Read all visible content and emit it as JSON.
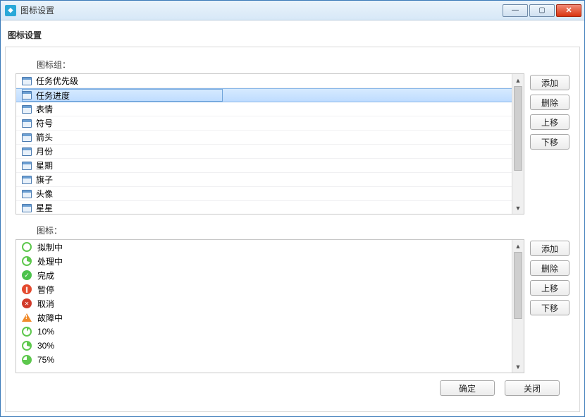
{
  "window": {
    "title": "图标设置"
  },
  "panel": {
    "header": "图标设置"
  },
  "labels": {
    "groups": "图标组：",
    "icons": "图标："
  },
  "groups": [
    {
      "label": "任务优先级"
    },
    {
      "label": "任务进度",
      "selected": true
    },
    {
      "label": "表情"
    },
    {
      "label": "符号"
    },
    {
      "label": "箭头"
    },
    {
      "label": "月份"
    },
    {
      "label": "星期"
    },
    {
      "label": "旗子"
    },
    {
      "label": "头像"
    },
    {
      "label": "星星"
    }
  ],
  "icons": [
    {
      "label": "拟制中",
      "kind": "pie0"
    },
    {
      "label": "处理中",
      "kind": "pie30"
    },
    {
      "label": "完成",
      "kind": "done"
    },
    {
      "label": "暂停",
      "kind": "pause"
    },
    {
      "label": "取消",
      "kind": "cancel"
    },
    {
      "label": "故障中",
      "kind": "warn"
    },
    {
      "label": "10%",
      "kind": "pie10"
    },
    {
      "label": "30%",
      "kind": "pie30"
    },
    {
      "label": "75%",
      "kind": "pie75"
    }
  ],
  "sideButtons": {
    "add": "添加",
    "del": "删除",
    "up": "上移",
    "down": "下移"
  },
  "footer": {
    "ok": "确定",
    "close": "关闭"
  }
}
